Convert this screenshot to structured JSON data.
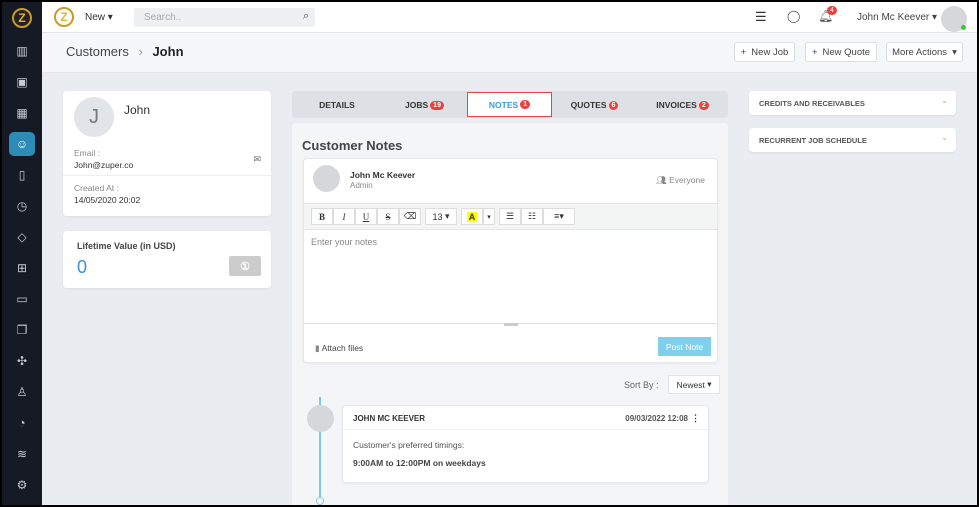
{
  "topbar": {
    "new_label": "New",
    "search_placeholder": "Search..",
    "notification_count": "4",
    "user_name": "John Mc Keever"
  },
  "breadcrumb": {
    "parent": "Customers",
    "current": "John"
  },
  "actions": {
    "new_job": "New Job",
    "new_quote": "New Quote",
    "more_actions": "More Actions"
  },
  "customer": {
    "initial": "J",
    "name": "John",
    "email_label": "Email :",
    "email": "John@zuper.co",
    "created_label": "Created At :",
    "created": "14/05/2020 20:02"
  },
  "lifetime": {
    "label": "Lifetime Value (in USD)",
    "value": "0"
  },
  "tabs": [
    {
      "label": "DETAILS"
    },
    {
      "label": "JOBS",
      "count": "19"
    },
    {
      "label": "NOTES",
      "count": "1"
    },
    {
      "label": "QUOTES",
      "count": "6"
    },
    {
      "label": "INVOICES",
      "count": "2"
    }
  ],
  "notes": {
    "title": "Customer Notes",
    "author": "John Mc Keever",
    "role": "Admin",
    "visibility": "Everyone",
    "font_size": "13",
    "placeholder": "Enter your notes",
    "attach": "Attach files",
    "post": "Post Note",
    "sort_label": "Sort By :",
    "sort_value": "Newest"
  },
  "note_items": [
    {
      "author": "JOHN MC KEEVER",
      "date": "09/03/2022 12:08",
      "line1": "Customer's preferred timings:",
      "line2": "9:00AM to 12:00PM on weekdays"
    }
  ],
  "right_panels": [
    {
      "label": "CREDITS AND RECEIVABLES"
    },
    {
      "label": "RECURRENT JOB SCHEDULE"
    }
  ],
  "colors": {
    "accent": "#2d8bb5",
    "badge": "#e8423f",
    "post_button": "#7fd0ea"
  }
}
